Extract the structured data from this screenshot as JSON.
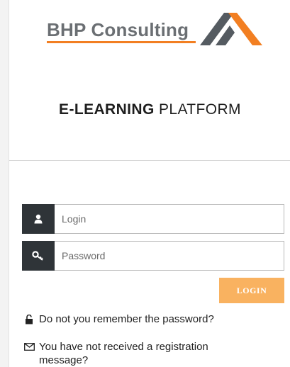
{
  "brand": {
    "name": "BHP Consulting",
    "text_color": "#6b6f73",
    "accent_color": "#f27f22",
    "mark_color": "#555b61"
  },
  "title": {
    "bold": "E-LEARNING",
    "regular": "PLATFORM"
  },
  "form": {
    "login": {
      "placeholder": "Login",
      "icon": "user-icon"
    },
    "password": {
      "placeholder": "Password",
      "icon": "key-icon"
    },
    "submit_label": "LOGIN",
    "icon_bg_color": "#2f3438",
    "button_color": "#f9b260"
  },
  "links": {
    "forgot_password": {
      "label": "Do not you remember the password?",
      "icon": "unlock-icon"
    },
    "no_registration": {
      "label": "You have not received a registration message?",
      "icon": "envelope-icon"
    }
  }
}
